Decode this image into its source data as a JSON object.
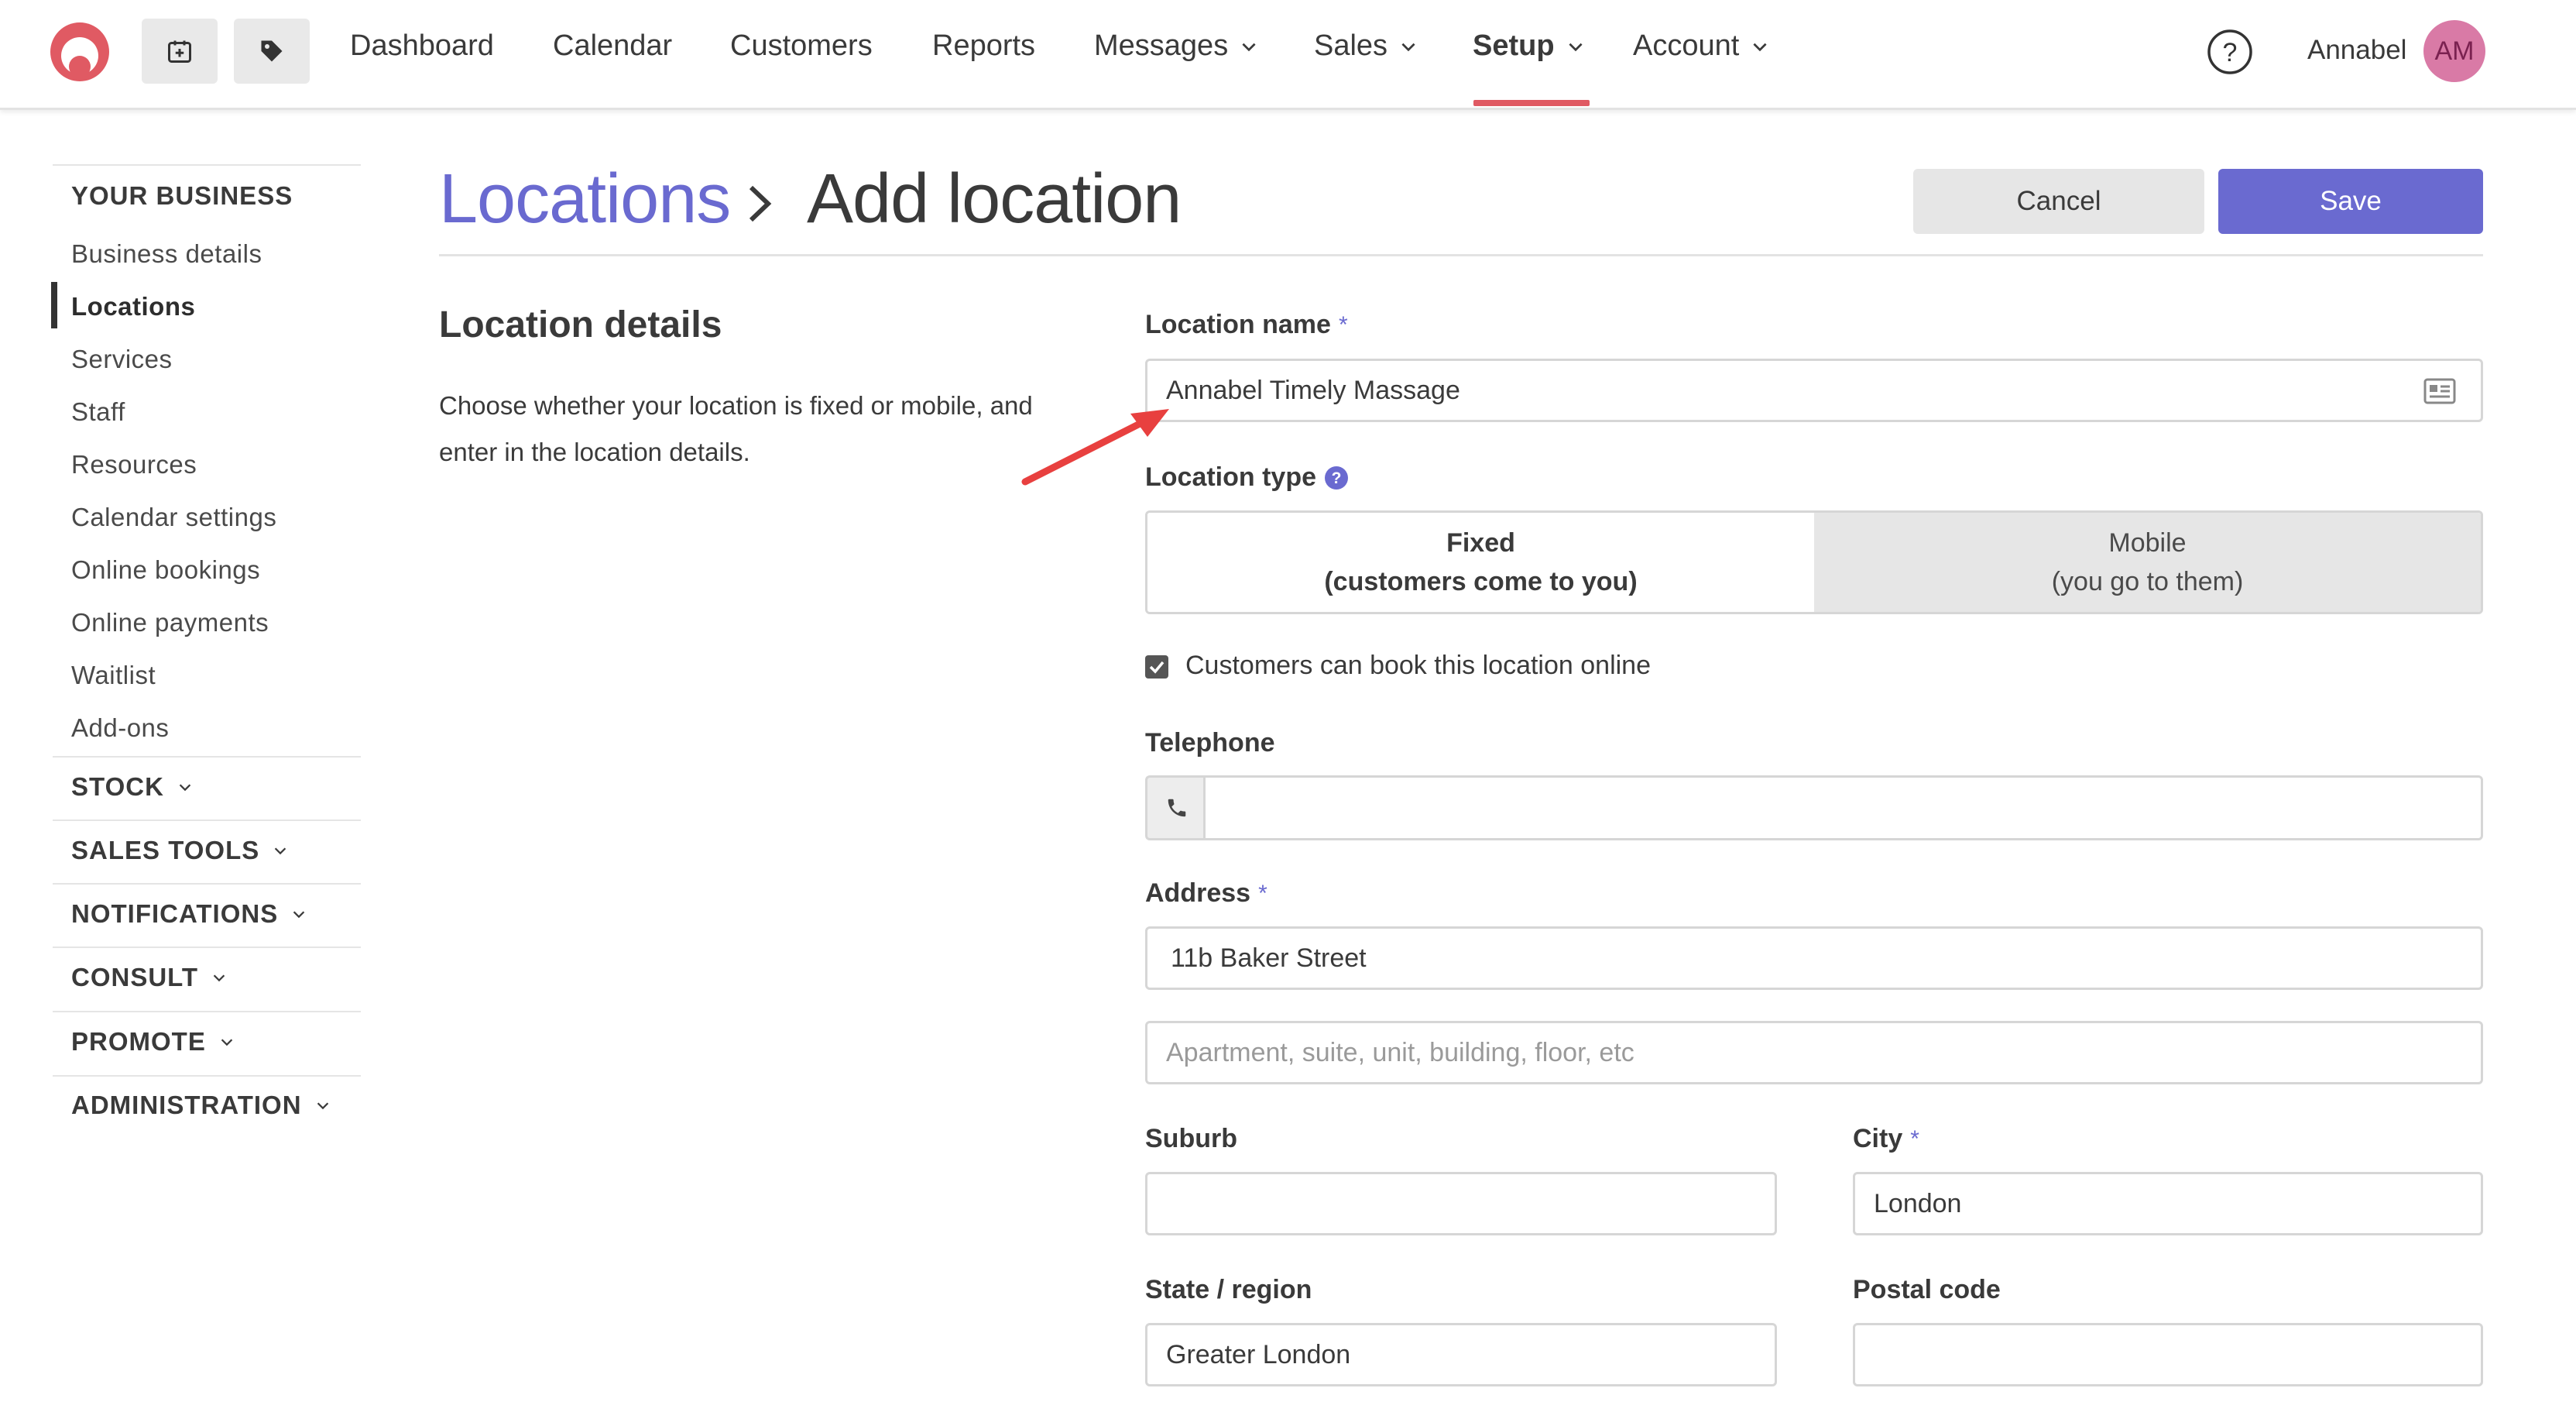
{
  "nav": {
    "items": [
      "Dashboard",
      "Calendar",
      "Customers",
      "Reports",
      "Messages",
      "Sales",
      "Setup",
      "Account"
    ],
    "active": "Setup",
    "user_name": "Annabel",
    "avatar_initials": "AM"
  },
  "sidebar": {
    "your_business": "YOUR BUSINESS",
    "items": [
      "Business details",
      "Locations",
      "Services",
      "Staff",
      "Resources",
      "Calendar settings",
      "Online bookings",
      "Online payments",
      "Waitlist",
      "Add-ons"
    ],
    "active": "Locations",
    "sections": [
      "STOCK",
      "SALES TOOLS",
      "NOTIFICATIONS",
      "CONSULT",
      "PROMOTE",
      "ADMINISTRATION"
    ]
  },
  "header": {
    "breadcrumb_parent": "Locations",
    "title": "Add location",
    "cancel_label": "Cancel",
    "save_label": "Save"
  },
  "section": {
    "title": "Location details",
    "description": "Choose whether your location is fixed or mobile, and enter in the location details."
  },
  "form": {
    "location_name_label": "Location name",
    "location_name_value": "Annabel Timely Massage",
    "location_type_label": "Location type",
    "type_fixed_title": "Fixed",
    "type_fixed_sub": "(customers come to you)",
    "type_mobile_title": "Mobile",
    "type_mobile_sub": "(you go to them)",
    "selected_type": "Fixed",
    "book_online_label": "Customers can book this location online",
    "book_online_checked": true,
    "telephone_label": "Telephone",
    "telephone_value": "",
    "address_label": "Address",
    "address_line1": "11b Baker Street",
    "address_line2_placeholder": "Apartment, suite, unit, building, floor, etc",
    "suburb_label": "Suburb",
    "suburb_value": "",
    "city_label": "City",
    "city_value": "London",
    "state_label": "State / region",
    "state_value": "Greater London",
    "postal_label": "Postal code",
    "postal_value": "",
    "required_mark": "*"
  },
  "colors": {
    "brand": "#e05a63",
    "accent": "#6a6ad0",
    "annotation_arrow": "#e8403f"
  }
}
